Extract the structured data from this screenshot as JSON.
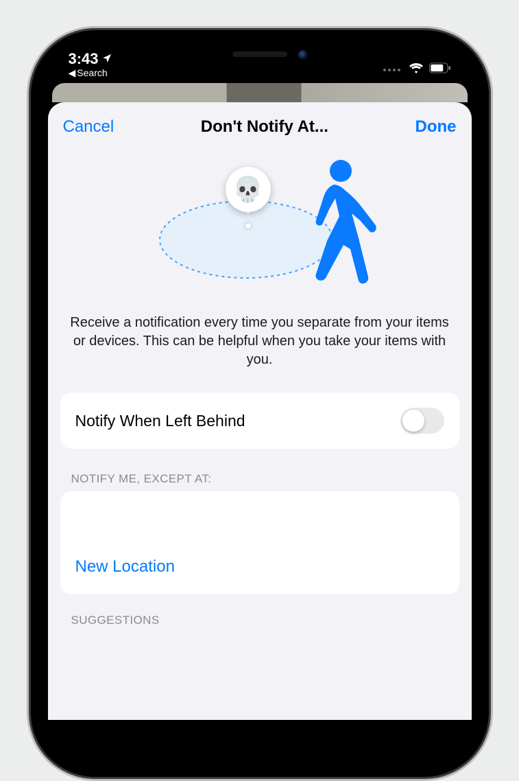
{
  "status": {
    "time": "3:43",
    "back_label": "Search"
  },
  "nav": {
    "cancel": "Cancel",
    "title": "Don't Notify At...",
    "done": "Done"
  },
  "illustration": {
    "pin_emoji": "💀"
  },
  "description": "Receive a notification every time you separate from your items or devices. This can be helpful when you take your items with you.",
  "toggle": {
    "label": "Notify When Left Behind",
    "value_on": false
  },
  "sections": {
    "except_header": "Notify me, except at:",
    "new_location": "New Location",
    "suggestions_header": "Suggestions"
  }
}
